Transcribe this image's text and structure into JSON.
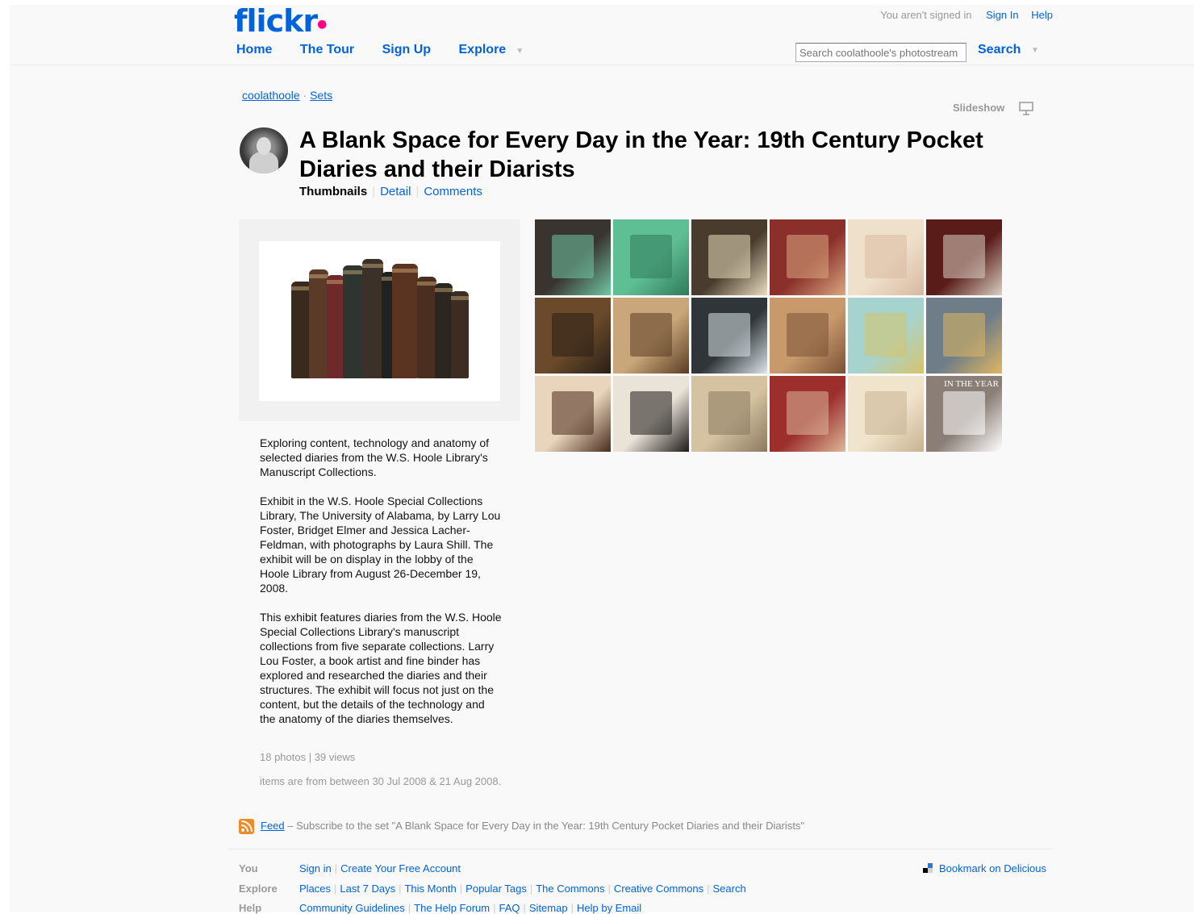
{
  "header": {
    "logo": "flickr",
    "status_text": "You aren't signed in",
    "signin_label": "Sign In",
    "help_label": "Help",
    "nav": [
      "Home",
      "The Tour",
      "Sign Up",
      "Explore"
    ],
    "search_placeholder": "Search coolathoole's photostream",
    "search_button": "Search"
  },
  "breadcrumb": {
    "user": "coolathoole",
    "separator": "·",
    "sets": "Sets"
  },
  "slideshow_label": "Slideshow",
  "set": {
    "title": "A Blank Space for Every Day in the Year: 19th Century Pocket Diaries and their Diarists",
    "tabs": [
      "Thumbnails",
      "Detail",
      "Comments"
    ],
    "description": [
      "Exploring content, technology and anatomy of selected diaries from the W.S. Hoole Library's Manuscript Collections.",
      "Exhibit in the W.S. Hoole Special Collections Library, The University of Alabama, by Larry Lou Foster, Bridget Elmer and Jessica Lacher-Feldman, with photographs by Laura Shill. The exhibit will be on display in the lobby of the Hoole Library from August 26-December 19, 2008.",
      "This exhibit features diaries from the W.S. Hoole Special Collections Library's manuscript collections from five separate collections. Larry Lou Foster, a book artist and fine binder has explored and researched the diaries and their structures. The exhibit will focus not just on the content, but the details of the technology and the anatomy of the diaries themselves."
    ],
    "stats": "18 photos | 39 views",
    "dates": "items are from between 30 Jul 2008 & 21 Aug 2008."
  },
  "thumbnails": [
    {
      "name": "thumb-1",
      "bg": "#3a3430",
      "accent": "#6fc7a4"
    },
    {
      "name": "thumb-2",
      "bg": "#5fbf94",
      "accent": "#2f7a5a"
    },
    {
      "name": "thumb-3",
      "bg": "#4a3c2c",
      "accent": "#e9dcc0"
    },
    {
      "name": "thumb-4",
      "bg": "#8b2f2a",
      "accent": "#d9a77f"
    },
    {
      "name": "thumb-5",
      "bg": "#efe0cc",
      "accent": "#d8b9a0"
    },
    {
      "name": "thumb-6",
      "bg": "#5a1c18",
      "accent": "#d9cfc4"
    },
    {
      "name": "thumb-7",
      "bg": "#6a4a2a",
      "accent": "#2a1f17"
    },
    {
      "name": "thumb-8",
      "bg": "#c9a77a",
      "accent": "#5a3c22"
    },
    {
      "name": "thumb-9",
      "bg": "#2f3538",
      "accent": "#dde4ea"
    },
    {
      "name": "thumb-10",
      "bg": "#c89a6b",
      "accent": "#7a5236"
    },
    {
      "name": "thumb-11",
      "bg": "#a7d3cf",
      "accent": "#d7c46a"
    },
    {
      "name": "thumb-12",
      "bg": "#6e7d88",
      "accent": "#e0b660"
    },
    {
      "name": "thumb-13",
      "bg": "#e8d5bb",
      "accent": "#4a2c1e"
    },
    {
      "name": "thumb-14",
      "bg": "#e9e3d8",
      "accent": "#1e1a18"
    },
    {
      "name": "thumb-15",
      "bg": "#d4c2a0",
      "accent": "#8a7a60"
    },
    {
      "name": "thumb-16",
      "bg": "#9c2e2b",
      "accent": "#ddb89a"
    },
    {
      "name": "thumb-17",
      "bg": "#f1e4cc",
      "accent": "#c7b391"
    },
    {
      "name": "thumb-18",
      "bg": "#8a7e76",
      "accent": "#ffffff",
      "text": "IN THE YEAR"
    }
  ],
  "feed": {
    "link": "Feed",
    "text": "– Subscribe to the set \"A Blank Space for Every Day in the Year: 19th Century Pocket Diaries and their Diarists\""
  },
  "footer": {
    "rows": [
      {
        "label": "You",
        "links": [
          "Sign in",
          "Create Your Free Account"
        ]
      },
      {
        "label": "Explore",
        "links": [
          "Places",
          "Last 7 Days",
          "This Month",
          "Popular Tags",
          "The Commons",
          "Creative Commons",
          "Search"
        ]
      },
      {
        "label": "Help",
        "links": [
          "Community Guidelines",
          "The Help Forum",
          "FAQ",
          "Sitemap",
          "Help by Email"
        ]
      }
    ],
    "delicious": "Bookmark on Delicious"
  },
  "colors": {
    "link": "#0063dc",
    "brand_pink": "#ff0084",
    "feed": "#f08a24"
  }
}
